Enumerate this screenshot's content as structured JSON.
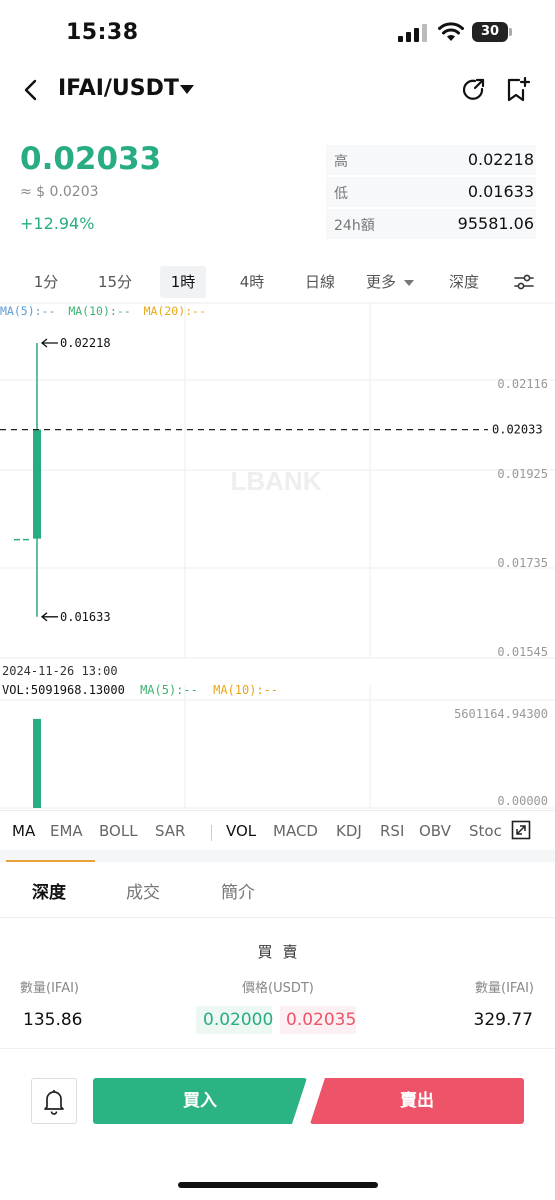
{
  "status_bar": {
    "time": "15:38",
    "battery": "30"
  },
  "header": {
    "pair": "IFAI/USDT"
  },
  "price": {
    "last": "0.02033",
    "approx": "≈ $ 0.0203",
    "change": "+12.94%"
  },
  "stats": [
    {
      "label": "高",
      "value": "0.02218"
    },
    {
      "label": "低",
      "value": "0.01633"
    },
    {
      "label": "24h額",
      "value": "95581.06"
    }
  ],
  "intervals": [
    "1分",
    "15分",
    "1時",
    "4時",
    "日線",
    "更多",
    "深度"
  ],
  "active_interval": "1時",
  "chart": {
    "ma_legend": {
      "ma5": "MA(5):--",
      "ma10": "MA(10):--",
      "ma20": "MA(20):--"
    },
    "watermark": "LBANK",
    "high_marker": "0.02218",
    "low_marker": "0.01633",
    "price_axis": [
      "0.02116",
      "0.01925",
      "0.01735",
      "0.01545"
    ],
    "current_price_tag": "0.02033",
    "time_label": "2024-11-26 13:00",
    "vol_legend": {
      "vol": "VOL:5091968.13000",
      "ma5": "MA(5):--",
      "ma10": "MA(10):--"
    },
    "vol_axis": [
      "5601164.94300",
      "0.00000"
    ],
    "colors": {
      "up": "#28ac84",
      "down": "#ed5469",
      "ma5": "#5b9bd5",
      "ma10": "#3cb371",
      "ma20": "#e6a817"
    }
  },
  "chart_data": {
    "type": "candlestick",
    "interval": "1時",
    "candles": [
      {
        "time": "2024-11-26 13:00",
        "open": 0.018,
        "high": 0.02218,
        "low": 0.01633,
        "close": 0.02033,
        "volume": 5091968.13
      }
    ],
    "ylim": [
      0.01545,
      0.02218
    ],
    "vol_ylim": [
      0,
      5601164.943
    ]
  },
  "indicators_main": [
    "MA",
    "EMA",
    "BOLL",
    "SAR"
  ],
  "indicators_sub": [
    "VOL",
    "MACD",
    "KDJ",
    "RSI",
    "OBV",
    "Stoc"
  ],
  "bottom_tabs": [
    "深度",
    "成交",
    "簡介"
  ],
  "order_book": {
    "title": "買賣",
    "col_qty_left": "數量(IFAI)",
    "col_price": "價格(USDT)",
    "col_qty_right": "數量(IFAI)",
    "rows": [
      {
        "bid_qty": "135.86",
        "bid_price": "0.02000",
        "ask_price": "0.02035",
        "ask_qty": "329.77"
      }
    ]
  },
  "actions": {
    "buy": "買入",
    "sell": "賣出"
  }
}
